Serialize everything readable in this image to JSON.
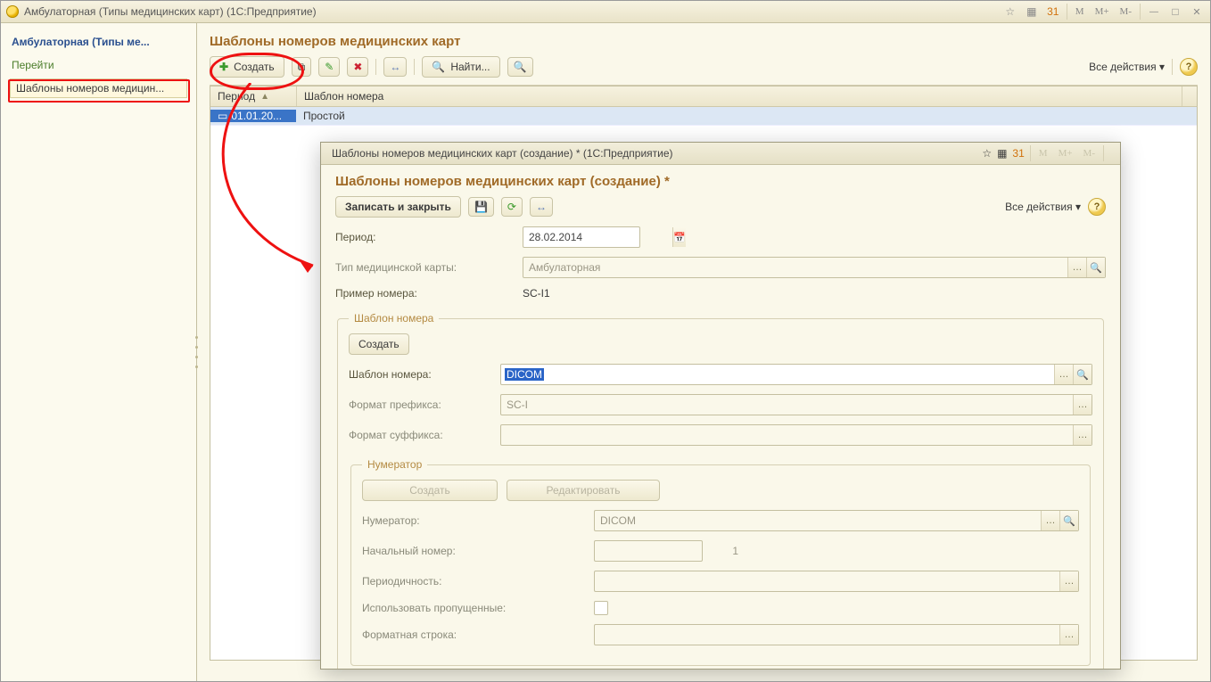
{
  "app": {
    "title": "Амбулаторная (Типы медицинских карт)  (1С:Предприятие)",
    "titlebar": {
      "m": "M",
      "m_plus": "M+",
      "m_minus": "M-"
    }
  },
  "sidebar": {
    "title": "Амбулаторная (Типы ме...",
    "go_label": "Перейти",
    "item": "Шаблоны номеров медицин..."
  },
  "main": {
    "title": "Шаблоны номеров медицинских карт",
    "toolbar": {
      "create": "Создать",
      "find": "Найти...",
      "actions": "Все действия"
    },
    "grid": {
      "headers": {
        "period": "Период",
        "template": "Шаблон номера"
      },
      "rows": [
        {
          "period": "01.01.20...",
          "template": "Простой"
        }
      ]
    }
  },
  "dialog": {
    "titlebar": "Шаблоны номеров медицинских карт (создание) * (1С:Предприятие)",
    "heading": "Шаблоны номеров медицинских карт (создание) *",
    "toolbar": {
      "save_close": "Записать и закрыть",
      "actions": "Все действия"
    },
    "m": "M",
    "m_plus": "M+",
    "m_minus": "M-",
    "fields": {
      "period_label": "Период:",
      "period_value": "28.02.2014",
      "type_label": "Тип медицинской карты:",
      "type_value": "Амбулаторная",
      "example_label": "Пример номера:",
      "example_value": "SC-I1"
    },
    "template_box": {
      "legend": "Шаблон номера",
      "create": "Создать",
      "template_label": "Шаблон номера:",
      "template_value": "DICOM",
      "prefix_label": "Формат префикса:",
      "prefix_value": "SC-I",
      "suffix_label": "Формат суффикса:",
      "suffix_value": ""
    },
    "numerator_box": {
      "legend": "Нумератор",
      "create": "Создать",
      "edit": "Редактировать",
      "numerator_label": "Нумератор:",
      "numerator_value": "DICOM",
      "start_label": "Начальный номер:",
      "start_value": "1",
      "periodicity_label": "Периодичность:",
      "periodicity_value": "",
      "use_skipped_label": "Использовать пропущенные:",
      "fmt_label": "Форматная строка:",
      "fmt_value": ""
    }
  },
  "icons": {
    "star": "☆",
    "calc": "▦",
    "cal31": "31",
    "plus": "✚",
    "copy": "⧉",
    "pencil": "✎",
    "delete": "✖",
    "swap": "↔",
    "magnifier": "🔍",
    "gear": "⚙",
    "dropdown": "▾",
    "save": "💾",
    "refresh_doc": "⟳",
    "sort_asc": "▲",
    "card": "▭",
    "ellipsis": "…"
  }
}
